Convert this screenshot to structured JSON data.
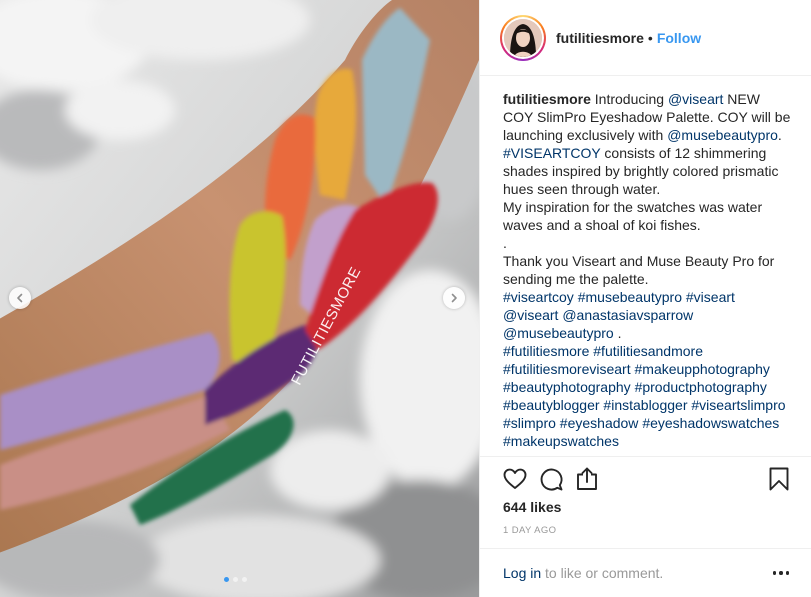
{
  "image": {
    "watermark": "FUTILITIESMORE",
    "carousel_dots": 3,
    "active_dot": 0,
    "swatch_colors": [
      "#c98f86",
      "#9bb8c4",
      "#e7a93a",
      "#e96a3c",
      "#c2a0cc",
      "#c9c42f",
      "#a98fc6",
      "#5b2a73",
      "#cc2a32",
      "#23714c"
    ]
  },
  "header": {
    "username": "futilitiesmore",
    "separator": "•",
    "follow_label": "Follow"
  },
  "caption": {
    "username": "futilitiesmore",
    "lines": [
      [
        "Introducing ",
        {
          "link": "@viseart"
        },
        " NEW COY SlimPro Eyeshadow Palette. COY will be launching exclusively with ",
        {
          "link": "@musebeautypro"
        },
        ". ",
        {
          "link": "#VISEARTCOY"
        },
        " consists of 12 shimmering shades inspired by brightly colored prismatic hues seen through water."
      ],
      [
        "My inspiration for the swatches was water waves and a shoal of koi fishes."
      ],
      [
        "."
      ],
      [
        "Thank you Viseart and Muse Beauty Pro for sending me the palette."
      ],
      [
        {
          "link": "#viseartcoy"
        },
        " ",
        {
          "link": "#musebeautypro"
        },
        " ",
        {
          "link": "#viseart"
        },
        " ",
        {
          "link": "@viseart"
        },
        " ",
        {
          "link": "@anastasiavsparrow"
        },
        " ",
        {
          "link": "@musebeautypro"
        },
        " ."
      ],
      [
        {
          "link": "#futilitiesmore"
        },
        " ",
        {
          "link": "#futilitiesandmore"
        },
        " ",
        {
          "link": "#futilitiesmoreviseart"
        },
        " ",
        {
          "link": "#makeupphotography"
        },
        " ",
        {
          "link": "#beautyphotography"
        },
        " ",
        {
          "link": "#productphotography"
        },
        " ",
        {
          "link": "#beautyblogger"
        },
        " ",
        {
          "link": "#instablogger"
        },
        " ",
        {
          "link": "#viseartslimpro"
        },
        " ",
        {
          "link": "#slimpro"
        },
        " ",
        {
          "link": "#eyeshadow"
        },
        " ",
        {
          "link": "#eyeshadowswatches"
        },
        " ",
        {
          "link": "#makeupswatches"
        }
      ]
    ]
  },
  "actions": {
    "like_icon": "heart-icon",
    "comment_icon": "comment-icon",
    "share_icon": "share-icon",
    "save_icon": "bookmark-icon"
  },
  "likes": "644 likes",
  "timestamp": "1 DAY AGO",
  "footer": {
    "login_label": "Log in",
    "rest_label": " to like or comment."
  },
  "colors": {
    "link": "#003569",
    "follow": "#3897f0",
    "muted": "#999999"
  }
}
